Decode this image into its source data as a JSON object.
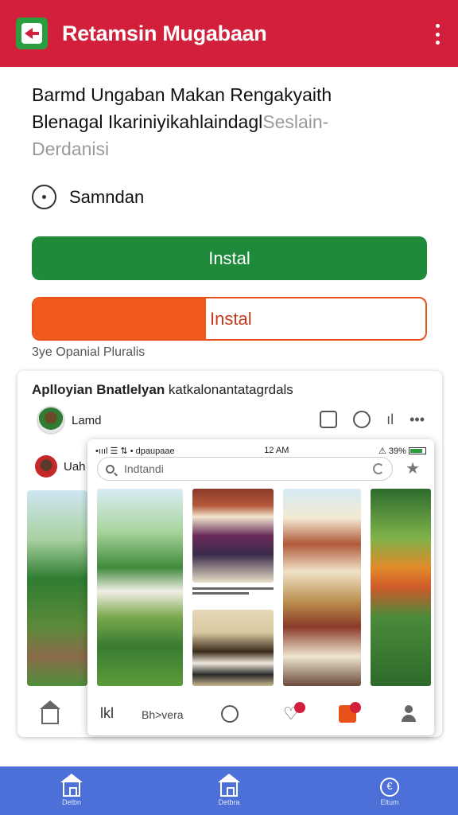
{
  "appbar": {
    "title": "Retamsin Mugabaan",
    "bg_color": "#d21f3c",
    "icon": "app-logo-icon",
    "menu_icon": "kebab-menu-icon"
  },
  "description": {
    "line1": "Barmd Ungaban Makan Rengakyaith",
    "line2_main": "Blenagal Ikariniyikahlaindagl",
    "line2_faded": "Seslain-",
    "line3": "Derdanisi"
  },
  "option": {
    "label": "Samndan"
  },
  "buttons": {
    "install_label": "Instal",
    "install_color": "#1e8a3a",
    "progress_label": "Instal",
    "progress_fraction": 0.44,
    "progress_color": "#ef5a1c",
    "note": "3ye Opanial Pluralis"
  },
  "preview": {
    "title_bold": "Aplloyian Bnatlelyan",
    "title_rest": " katkalonantatagrdals",
    "post_name": "Lamd",
    "row2_name": "Uah",
    "bottom_label": "Bh>vera",
    "phone": {
      "time": "12 AM",
      "status_left": "•ıııl ☰ ⇅ • dpaupaae",
      "status_right": "⚠ 39% ",
      "search_placeholder": "Indtandi"
    }
  },
  "navbar": {
    "bg_color": "#4d6fd8",
    "items": [
      {
        "label": "Detbn",
        "icon": "home-icon"
      },
      {
        "label": "Detbra",
        "icon": "home-outline-icon"
      },
      {
        "label": "Eltum",
        "icon": "currency-icon"
      }
    ]
  }
}
